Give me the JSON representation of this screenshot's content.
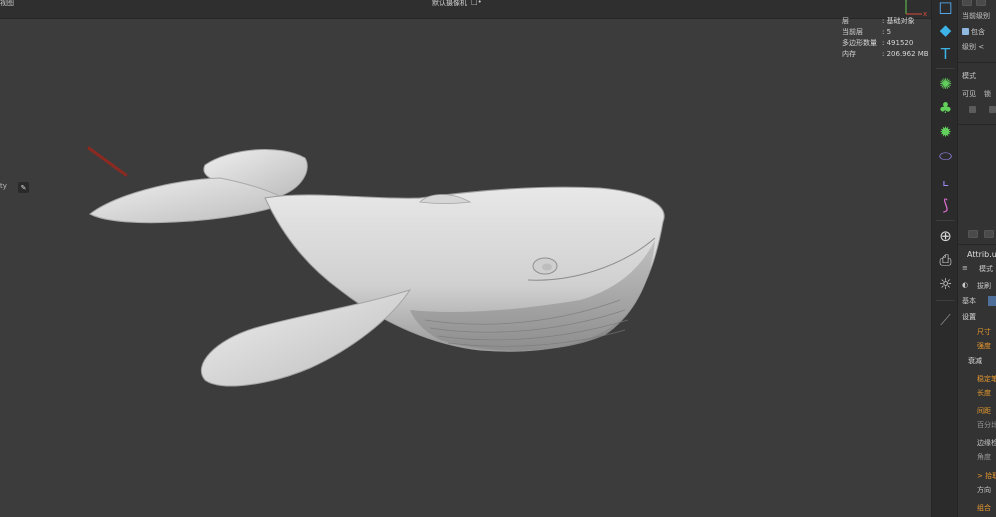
{
  "viewport": {
    "view_name": "视图",
    "camera_label": "默认摄像机",
    "camera_icon": "□•",
    "hud": [
      {
        "label": "层",
        "value": ": 基础对象"
      },
      {
        "label": "当前层",
        "value": ": 5"
      },
      {
        "label": "多边形数量",
        "value": ": 491520"
      },
      {
        "label": "内存",
        "value": ": 206.962 MB"
      }
    ],
    "side_tag": "ty",
    "side_button_icon": "brush-icon",
    "axis": {
      "y_label": "Y",
      "z_label": "x"
    },
    "model": "whale-sculpt",
    "colors": {
      "background": "#3c3c3c",
      "header": "#2f2f2f",
      "model": "#d9d9d9",
      "handle": "#8c2a22"
    }
  },
  "tools": [
    {
      "name": "cube-outline-icon",
      "glyph": "□",
      "color": "#5ab4ff"
    },
    {
      "name": "cube-icon",
      "glyph": "◆",
      "color": "#3db3e8"
    },
    {
      "name": "text-icon",
      "glyph": "T",
      "color": "#3db3e8"
    },
    {
      "name": "generator-icon",
      "glyph": "✺",
      "color": "#62d15c"
    },
    {
      "name": "cloner-icon",
      "glyph": "♣",
      "color": "#62d15c"
    },
    {
      "name": "gear-effector-icon",
      "glyph": "✹",
      "color": "#62d15c"
    },
    {
      "name": "deformer-icon",
      "glyph": "⬭",
      "color": "#9b8cff"
    },
    {
      "name": "bend-deformer-icon",
      "glyph": "⌞",
      "color": "#9b8cff"
    },
    {
      "name": "spline-icon",
      "glyph": "⟆",
      "color": "#e070d0"
    },
    {
      "name": "globe-icon",
      "glyph": "⊕",
      "color": "#d8d8d8"
    },
    {
      "name": "camera-icon",
      "glyph": "⎙",
      "color": "#d8d8d8"
    },
    {
      "name": "light-icon",
      "glyph": "☼",
      "color": "#d8d8d8"
    },
    {
      "name": "sculpt-icon",
      "glyph": "⟋",
      "color": "#8a8a8a"
    }
  ],
  "attributes": {
    "top_label": "当前级别",
    "include_label": "包含",
    "level_label": "级别 <",
    "mode_label": "模式",
    "visible_label": "可见",
    "lock_label": "锁",
    "panel_title": "Attrib.ute",
    "menu_mode": "模式",
    "brush_label": "拔刷",
    "tab_basic": "基本",
    "settings_header": "设置",
    "size_label": "尺寸",
    "strength_label": "强度",
    "falloff_label": "衰减",
    "stabilize_label": "稳定笔",
    "length_label": "长度",
    "spacing_label": "间距",
    "percent_label": "百分比",
    "edge_label": "边缘检",
    "angle_label": "角度",
    "stamp_label": "> 拾取",
    "direction_label": "方向",
    "group_label": "组合",
    "accent": "#e89a2e"
  }
}
